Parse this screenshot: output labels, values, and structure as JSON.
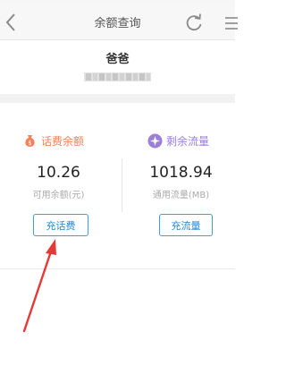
{
  "nav": {
    "title": "余额查询",
    "back_icon": "chevron-left-icon",
    "refresh_icon": "refresh-icon",
    "menu_icon": "menu-icon"
  },
  "profile": {
    "name": "爸爸"
  },
  "balance": {
    "label": "话费余额",
    "icon": "money-bag-icon",
    "value": "10.26",
    "sub_label": "可用余额(元)",
    "button_label": "充话费",
    "accent_color": "#f4805c"
  },
  "data_usage": {
    "label": "剩余流量",
    "icon": "sparkle-icon",
    "value": "1018.94",
    "sub_label": "通用流量(MB)",
    "button_label": "充流量",
    "accent_color": "#9b7fd8"
  },
  "annotation": {
    "arrow_color": "#e53935"
  }
}
